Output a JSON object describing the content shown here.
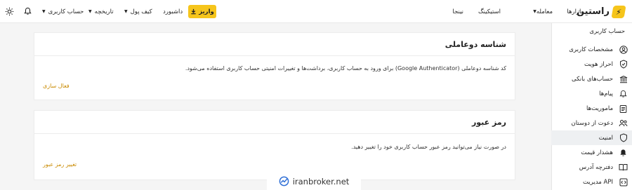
{
  "header": {
    "logo_text": "راستین",
    "nav": [
      "بازارها",
      "معامله",
      "استیکینگ",
      "نینجا"
    ],
    "account_label": "حساب کاربری",
    "history_label": "تاریخچه",
    "wallet_label": "کیف پول",
    "dashboard_label": "داشبورد",
    "deposit_label": "واریز"
  },
  "sidebar": {
    "title": "حساب کاربری",
    "items": [
      {
        "label": "مشخصات کاربری",
        "icon": "user-icon"
      },
      {
        "label": "احراز هویت",
        "icon": "shield-check-icon"
      },
      {
        "label": "حساب‌های بانکی",
        "icon": "bank-icon"
      },
      {
        "label": "پیام‌ها",
        "icon": "bell-icon"
      },
      {
        "label": "ماموریت‌ها",
        "icon": "clipboard-icon"
      },
      {
        "label": "دعوت از دوستان",
        "icon": "users-icon"
      },
      {
        "label": "امنیت",
        "icon": "shield-icon"
      },
      {
        "label": "هشدار قیمت",
        "icon": "alarm-bell-icon"
      },
      {
        "label": "دفترچه آدرس",
        "icon": "book-icon"
      },
      {
        "label": "مدیریت API",
        "icon": "api-icon"
      }
    ],
    "active_index": 6
  },
  "twofa": {
    "title": "شناسه دوعاملی",
    "description": "کد شناسه دوعاملی (Google Authenticator) برای ورود به حساب کاربری، برداشت‌ها و تغییرات امنیتی حساب کاربری استفاده می‌شود.",
    "action": "فعال سازی"
  },
  "password": {
    "title": "رمز عبور",
    "description": "در صورت نیاز می‌توانید رمز عبور حساب کاربری خود را تغییر دهید.",
    "action": "تغییر رمز عبور"
  },
  "watermark": {
    "text": "iranbroker.net"
  },
  "colors": {
    "accent": "#f6c51b",
    "link": "#c98a00",
    "active_bg": "#eef0f2"
  }
}
